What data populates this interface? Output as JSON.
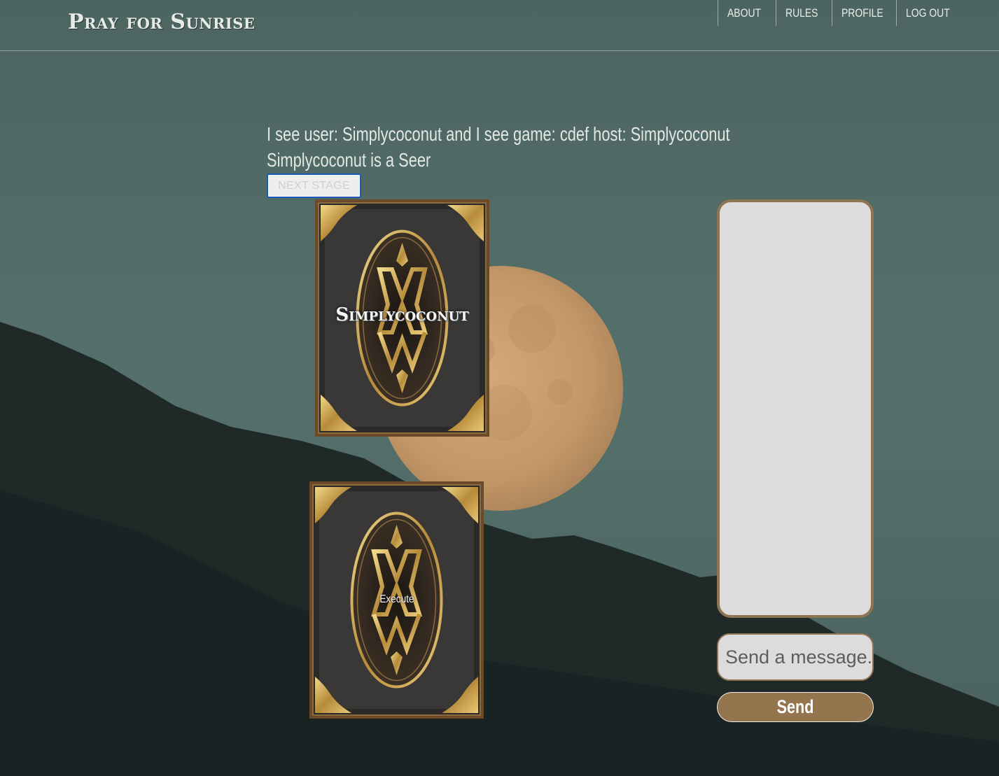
{
  "header": {
    "logo": "Pray for Sunrise",
    "nav": [
      {
        "label": "ABOUT"
      },
      {
        "label": "RULES"
      },
      {
        "label": "PROFILE"
      },
      {
        "label": "LOG OUT"
      }
    ]
  },
  "status": {
    "line1": "I see user: Simplycoconut and I see game: cdef host: Simplycoconut",
    "line2": "Simplycoconut is a Seer"
  },
  "controls": {
    "next_stage_label": "NEXT STAGE"
  },
  "cards": [
    {
      "label": "Simplycoconut"
    },
    {
      "label": "Execute"
    }
  ],
  "chat": {
    "placeholder": "Send a message...",
    "send_label": "Send"
  },
  "colors": {
    "sky": "#4f6763",
    "moon": "#c79a6b",
    "mountain": "#1f2a2a",
    "chat_border": "#8f7452",
    "send_button": "#94754e",
    "card_gold": "#c8a24f"
  },
  "icons": {
    "moon": "full-moon-image",
    "mountain": "mountain-silhouette-image",
    "card_back": "ornate-card-back-image"
  }
}
